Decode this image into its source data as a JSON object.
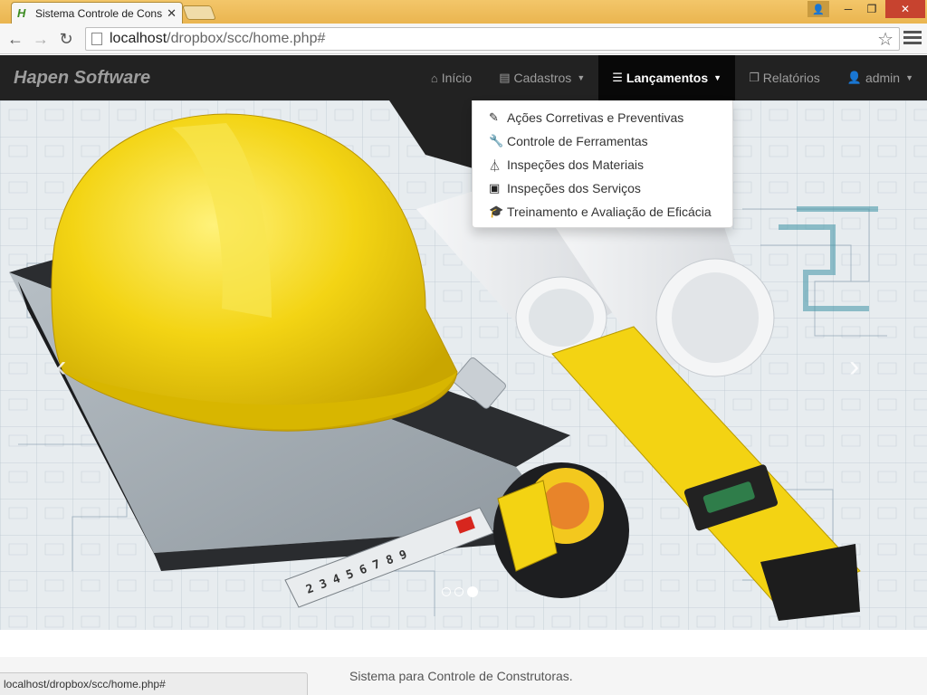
{
  "browser": {
    "tab_title": "Sistema Controle de Cons",
    "tab_close": "✕",
    "url_host": "localhost",
    "url_path": "/dropbox/scc/home.php#",
    "status_url": "localhost/dropbox/scc/home.php#"
  },
  "navbar": {
    "brand": "Hapen Software",
    "items": [
      {
        "label": "Início",
        "icon": "home-icon",
        "glyph": "⌂"
      },
      {
        "label": "Cadastros",
        "icon": "list-alt-icon",
        "glyph": "▤",
        "caret": "▼"
      },
      {
        "label": "Lançamentos",
        "icon": "th-list-icon",
        "glyph": "☰",
        "caret": "▼",
        "active": true
      },
      {
        "label": "Relatórios",
        "icon": "duplicate-icon",
        "glyph": "❐"
      },
      {
        "label": "admin",
        "icon": "user-icon",
        "glyph": "👤",
        "caret": "▼"
      }
    ]
  },
  "dropdown": {
    "items": [
      {
        "label": "Ações Corretivas e Preventivas",
        "icon": "edit-icon",
        "glyph": "✎"
      },
      {
        "label": "Controle de Ferramentas",
        "icon": "wrench-icon",
        "glyph": "🔧"
      },
      {
        "label": "Inspeções dos Materiais",
        "icon": "flask-icon",
        "glyph": "⏃"
      },
      {
        "label": "Inspeções dos Serviços",
        "icon": "briefcase-icon",
        "glyph": "▣"
      },
      {
        "label": "Treinamento e Avaliação de Eficácia",
        "icon": "education-icon",
        "glyph": "🎓"
      }
    ]
  },
  "carousel": {
    "prev_glyph": "‹",
    "next_glyph": "›",
    "slide_count": 3,
    "active_slide": 3
  },
  "footer": {
    "text": "Sistema para Controle de Construtoras."
  },
  "colors": {
    "navbar_bg": "#222222",
    "navbar_active": "#080808",
    "helmet": "#f2d21b",
    "level": "#f3d313"
  }
}
